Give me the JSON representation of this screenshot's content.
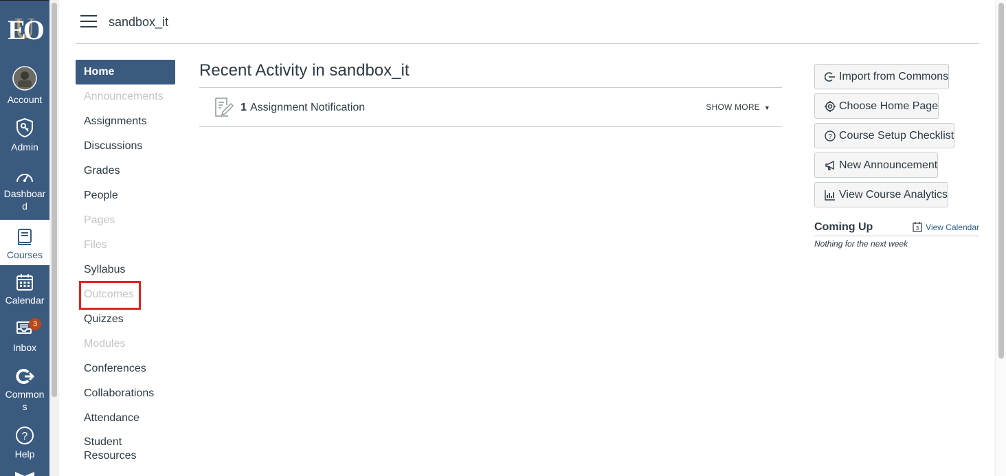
{
  "colors": {
    "nav_bg": "#3a5a80",
    "highlight": "#e3241d",
    "badge": "#b8481a"
  },
  "global_nav": {
    "logo_text": "EO",
    "items": [
      {
        "label": "Account",
        "icon": "avatar"
      },
      {
        "label": "Admin",
        "icon": "shield-icon"
      },
      {
        "label": "Dashboar d",
        "icon": "dashboard-gauge-icon"
      },
      {
        "label": "Courses",
        "icon": "book-icon",
        "active": true
      },
      {
        "label": "Calendar",
        "icon": "calendar-icon"
      },
      {
        "label": "Inbox",
        "icon": "inbox-icon",
        "badge": "3"
      },
      {
        "label": "Common s",
        "icon": "commons-icon"
      },
      {
        "label": "Help",
        "icon": "help-icon"
      }
    ]
  },
  "header": {
    "breadcrumb": "sandbox_it"
  },
  "course_nav": {
    "items": [
      {
        "label": "Home",
        "state": "active"
      },
      {
        "label": "Announcements",
        "state": "disabled"
      },
      {
        "label": "Assignments",
        "state": "enabled"
      },
      {
        "label": "Discussions",
        "state": "enabled"
      },
      {
        "label": "Grades",
        "state": "enabled"
      },
      {
        "label": "People",
        "state": "enabled"
      },
      {
        "label": "Pages",
        "state": "disabled"
      },
      {
        "label": "Files",
        "state": "disabled"
      },
      {
        "label": "Syllabus",
        "state": "enabled"
      },
      {
        "label": "Outcomes",
        "state": "disabled",
        "highlighted": true
      },
      {
        "label": "Quizzes",
        "state": "enabled"
      },
      {
        "label": "Modules",
        "state": "disabled"
      },
      {
        "label": "Conferences",
        "state": "enabled"
      },
      {
        "label": "Collaborations",
        "state": "enabled"
      },
      {
        "label": "Attendance",
        "state": "enabled"
      },
      {
        "label": "Student Resources",
        "state": "enabled"
      }
    ]
  },
  "main": {
    "title": "Recent Activity in sandbox_it",
    "activity": {
      "count": "1",
      "text": "Assignment Notification",
      "show_more": "SHOW MORE"
    }
  },
  "sidebar": {
    "buttons": [
      {
        "label": "Import from Commons",
        "icon": "commons-import-icon"
      },
      {
        "label": "Choose Home Page",
        "icon": "target-icon"
      },
      {
        "label": "Course Setup Checklist",
        "icon": "question-icon"
      },
      {
        "label": "New Announcement",
        "icon": "megaphone-icon"
      },
      {
        "label": "View Course Analytics",
        "icon": "analytics-icon"
      }
    ],
    "coming_up": {
      "title": "Coming Up",
      "view_calendar": "View Calendar",
      "calendar_day": "3",
      "empty": "Nothing for the next week"
    }
  }
}
